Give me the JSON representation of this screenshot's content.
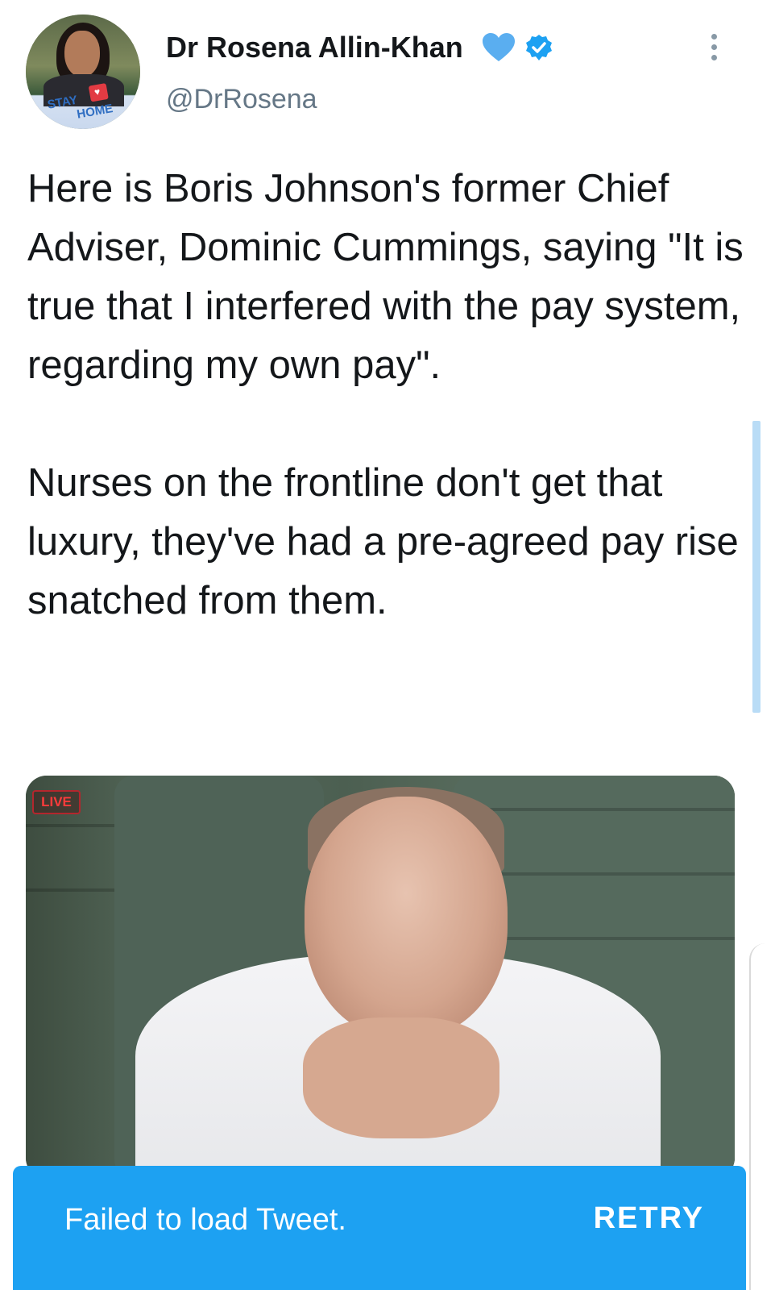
{
  "header": {
    "display_name": "Dr Rosena Allin-Khan",
    "handle": "@DrRosena",
    "avatar_badge": {
      "line1": "STAY",
      "line2": "HOME"
    },
    "icons": {
      "name_emoji": "blue-heart-icon",
      "verified": "verified-badge-icon",
      "more": "more-options-icon"
    },
    "colors": {
      "accent": "#1da1f2",
      "heart": "#5aaef0"
    }
  },
  "tweet": {
    "paragraph1": "Here is Boris Johnson's former Chief Adviser, Dominic Cummings, saying \"It is true that I interfered with the pay system, regarding my own pay\".",
    "paragraph2": "Nurses on the frontline don't get that luxury, they've had a pre-agreed pay rise snatched from them."
  },
  "media": {
    "live_label": "LIVE"
  },
  "toast": {
    "message": "Failed to load Tweet.",
    "action_label": "RETRY"
  }
}
